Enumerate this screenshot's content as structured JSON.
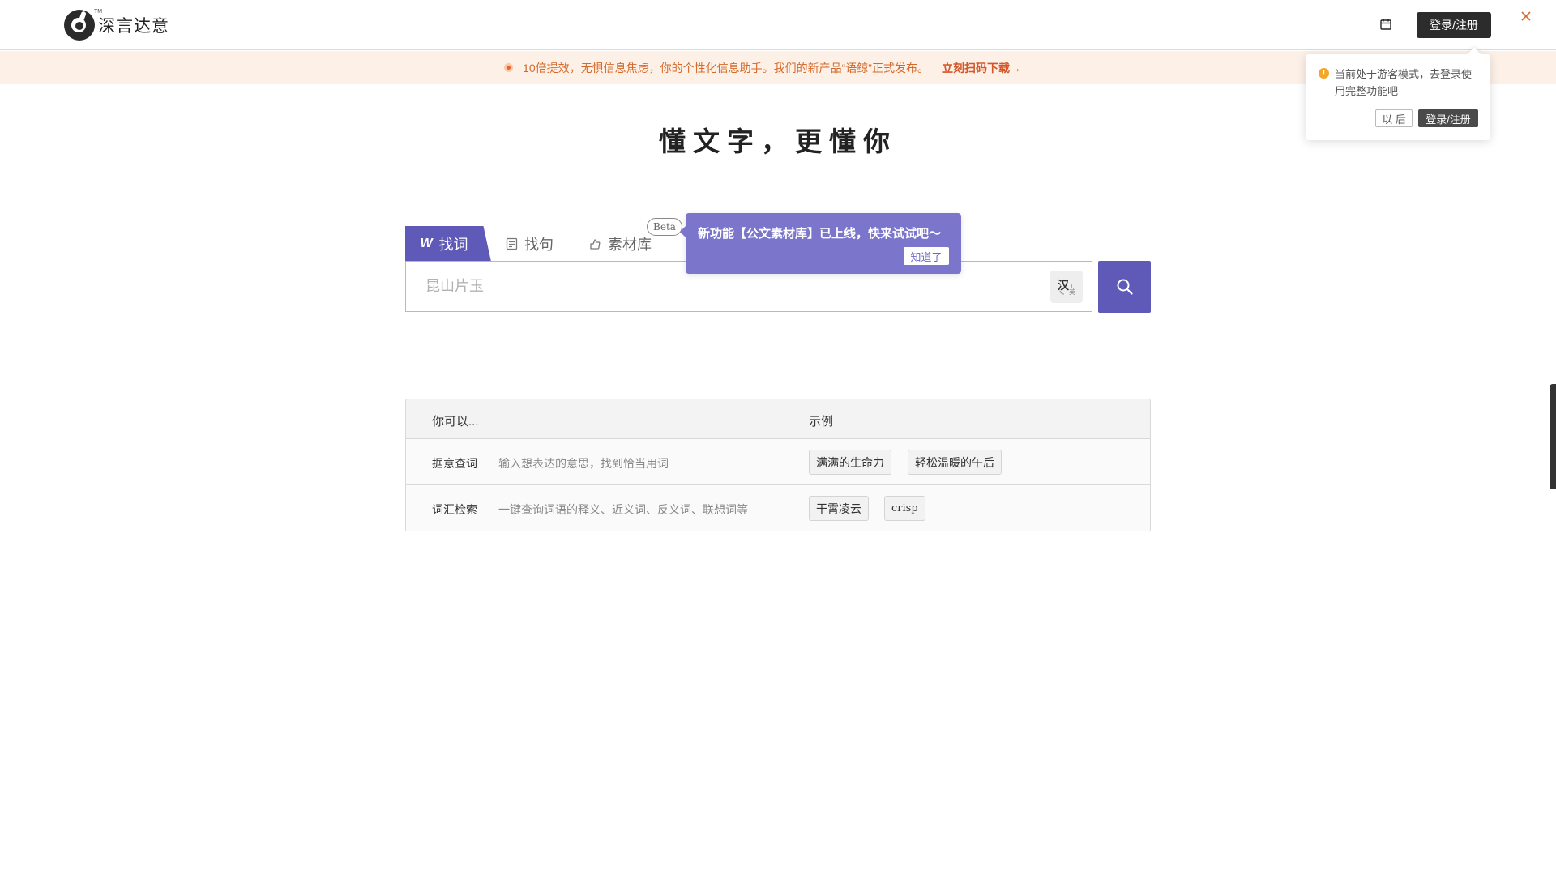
{
  "header": {
    "logo_text": "深言达意",
    "logo_tm": "TM",
    "calendar_icon": "calendar-icon",
    "login_label": "登录/注册"
  },
  "notice": {
    "text": "10倍提效，无惧信息焦虑，你的个性化信息助手。我们的新产品“语鲸”正式发布。",
    "link": "立刻扫码下载→",
    "close_icon": "close-icon",
    "color": "#d4692a"
  },
  "guest_popover": {
    "message": "当前处于游客模式，去登录使用完整功能吧",
    "later_label": "以 后",
    "login_label": "登录/注册"
  },
  "slogan": "懂文字，更懂你",
  "tabs": [
    {
      "label": "找词",
      "icon": "w-logo-icon",
      "active": true
    },
    {
      "label": "找句",
      "icon": "sentence-icon",
      "active": false
    },
    {
      "label": "素材库",
      "icon": "material-icon",
      "active": false
    }
  ],
  "beta_badge": "Beta",
  "feature_tip": {
    "text": "新功能【公文素材库】已上线，快来试试吧～",
    "button": "知道了"
  },
  "search": {
    "placeholder": "昆山片玉",
    "value": "",
    "lang_toggle_zh": "汉",
    "lang_toggle_en": "英",
    "button_icon": "search-icon"
  },
  "help_table": {
    "header_col1": "你可以...",
    "header_col2": "示例",
    "rows": [
      {
        "name": "据意查词",
        "desc": "输入想表达的意思，找到恰当用词",
        "examples": [
          "满满的生命力",
          "轻松温暖的午后"
        ]
      },
      {
        "name": "词汇检索",
        "desc": "一键查询词语的释义、近义词、反义词、联想词等",
        "examples": [
          "干霄凌云",
          "crisp"
        ]
      }
    ]
  },
  "colors": {
    "accent": "#5f59b8",
    "tooltip": "#7b76cc",
    "notice_bg": "#fdf1e7"
  }
}
